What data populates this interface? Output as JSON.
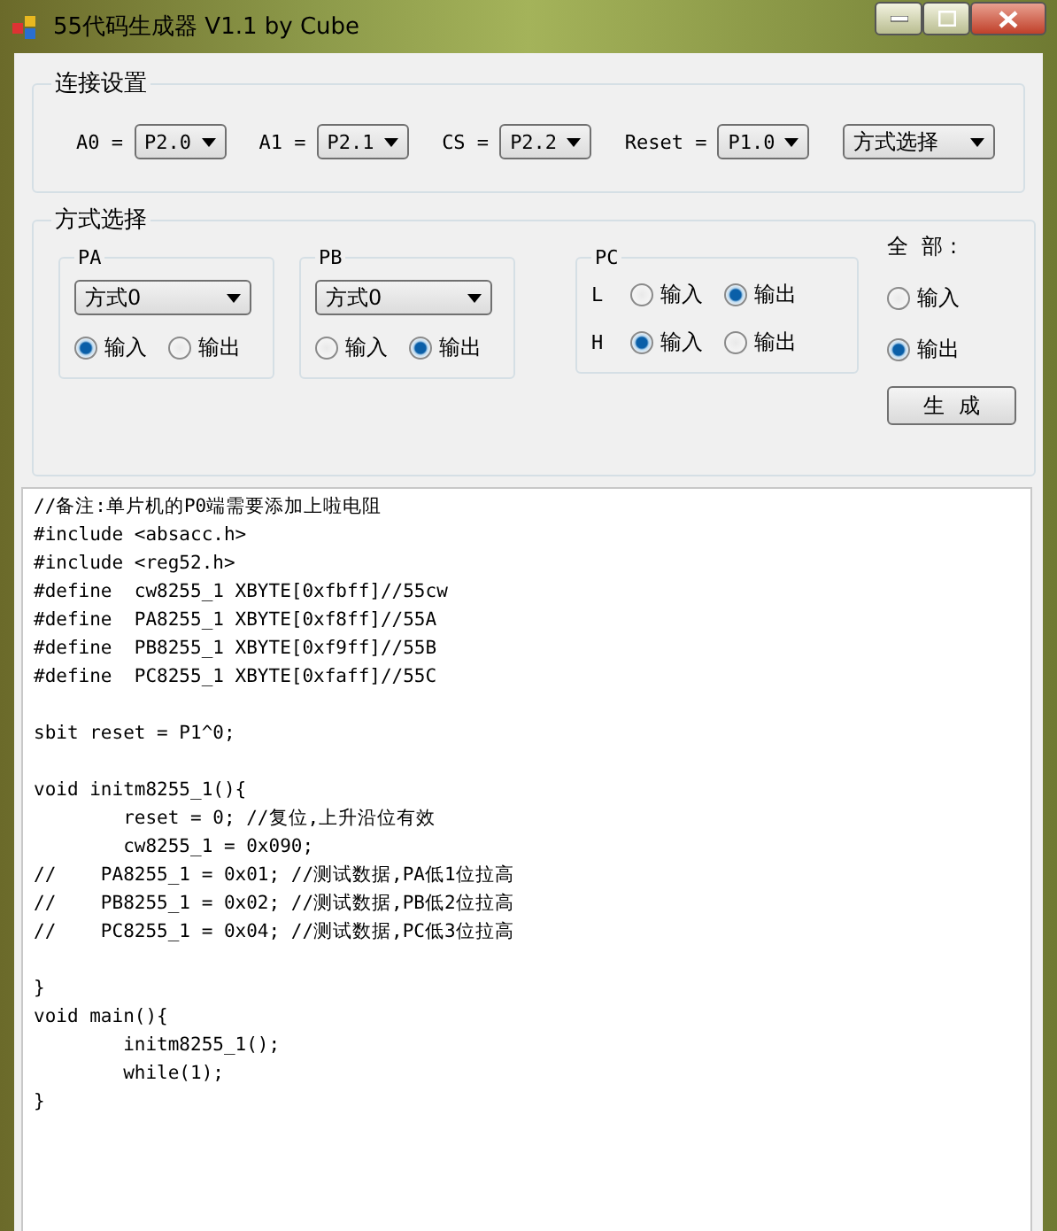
{
  "window": {
    "title": "55代码生成器 V1.1 by Cube"
  },
  "connection": {
    "title": "连接设置",
    "pins": [
      {
        "label": "A0 =",
        "value": "P2.0"
      },
      {
        "label": "A1 =",
        "value": "P2.1"
      },
      {
        "label": "CS =",
        "value": "P2.2"
      },
      {
        "label": "Reset =",
        "value": "P1.0"
      }
    ],
    "mode_select": "方式选择"
  },
  "mode": {
    "title": "方式选择",
    "ports": [
      {
        "name": "PA",
        "kind": "mode",
        "mode": "方式0",
        "options": [
          {
            "label": "输入",
            "selected": true
          },
          {
            "label": "输出",
            "selected": false
          }
        ]
      },
      {
        "name": "PB",
        "kind": "mode",
        "mode": "方式0",
        "options": [
          {
            "label": "输入",
            "selected": false
          },
          {
            "label": "输出",
            "selected": true
          }
        ]
      },
      {
        "name": "PC",
        "kind": "split",
        "rows": [
          {
            "label": "L",
            "options": [
              {
                "label": "输入",
                "selected": false
              },
              {
                "label": "输出",
                "selected": true
              }
            ]
          },
          {
            "label": "H",
            "options": [
              {
                "label": "输入",
                "selected": true
              },
              {
                "label": "输出",
                "selected": false
              }
            ]
          }
        ]
      }
    ],
    "all": {
      "label": "全  部 :",
      "options": [
        {
          "label": "输入",
          "selected": false
        },
        {
          "label": "输出",
          "selected": true
        }
      ]
    },
    "generate_button": "生  成"
  },
  "code": "//备注:单片机的P0端需要添加上啦电阻\n#include <absacc.h>\n#include <reg52.h>\n#define  cw8255_1 XBYTE[0xfbff]//55cw\n#define  PA8255_1 XBYTE[0xf8ff]//55A\n#define  PB8255_1 XBYTE[0xf9ff]//55B\n#define  PC8255_1 XBYTE[0xfaff]//55C\n\nsbit reset = P1^0;\n\nvoid initm8255_1(){\n        reset = 0; //复位,上升沿位有效\n        cw8255_1 = 0x090;\n//    PA8255_1 = 0x01; //测试数据,PA低1位拉高\n//    PB8255_1 = 0x02; //测试数据,PB低2位拉高\n//    PC8255_1 = 0x04; //测试数据,PC低3位拉高\n\n}\nvoid main(){\n        initm8255_1();\n        while(1);\n}"
}
